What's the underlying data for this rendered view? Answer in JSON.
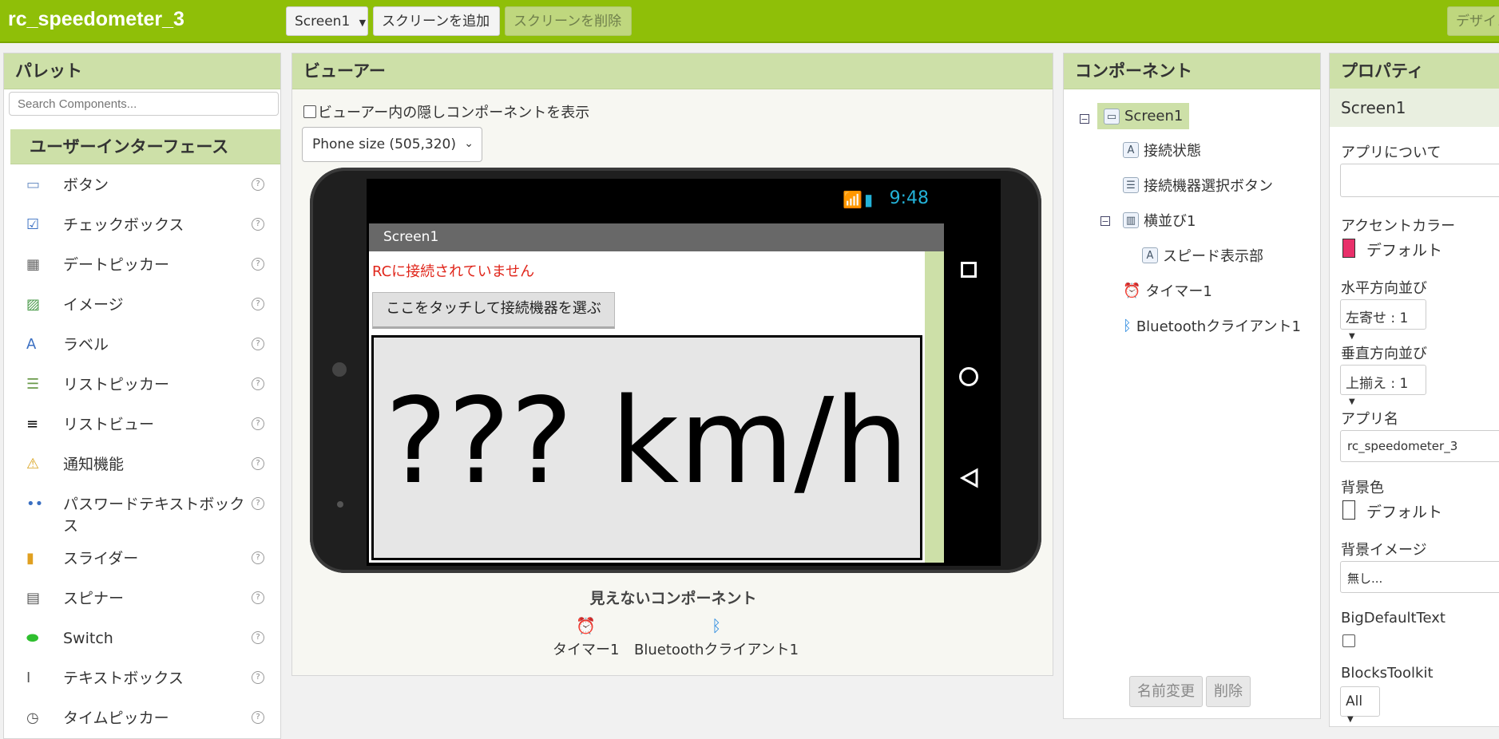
{
  "app": {
    "project_title": "rc_speedometer_3",
    "screen_select": "Screen1",
    "add_screen": "スクリーンを追加",
    "remove_screen": "スクリーンを削除",
    "designer_button": "デザイン編集"
  },
  "palette": {
    "title": "パレット",
    "search_placeholder": "Search Components...",
    "category": "ユーザーインターフェース",
    "help_glyph": "?",
    "items": [
      {
        "label": "ボタン",
        "icon": "button-icon"
      },
      {
        "label": "チェックボックス",
        "icon": "checkbox-icon"
      },
      {
        "label": "デートピッカー",
        "icon": "datepicker-icon"
      },
      {
        "label": "イメージ",
        "icon": "image-icon"
      },
      {
        "label": "ラベル",
        "icon": "label-icon"
      },
      {
        "label": "リストピッカー",
        "icon": "listpicker-icon"
      },
      {
        "label": "リストビュー",
        "icon": "listview-icon"
      },
      {
        "label": "通知機能",
        "icon": "notifier-icon"
      },
      {
        "label": "パスワードテキストボックス",
        "icon": "password-icon"
      },
      {
        "label": "スライダー",
        "icon": "slider-icon"
      },
      {
        "label": "スピナー",
        "icon": "spinner-icon"
      },
      {
        "label": "Switch",
        "icon": "switch-icon"
      },
      {
        "label": "テキストボックス",
        "icon": "textbox-icon"
      },
      {
        "label": "タイムピッカー",
        "icon": "timepicker-icon"
      }
    ]
  },
  "viewer": {
    "title": "ビューアー",
    "hidden_checkbox_label": "ビューアー内の隠しコンポーネントを表示",
    "size_select": "Phone size (505,320)",
    "phone": {
      "time": "9:48",
      "screen_title": "Screen1",
      "status_text": "RCに接続されていません",
      "touch_button": "ここをタッチして接続機器を選ぶ",
      "speed_text": "??? km/h"
    },
    "nonvisible_title": "見えないコンポーネント",
    "nonvisible": [
      {
        "label": "タイマー1",
        "icon": "timer-icon"
      },
      {
        "label": "Bluetoothクライアント1",
        "icon": "bluetooth-icon"
      }
    ]
  },
  "components": {
    "title": "コンポーネント",
    "tree": {
      "screen": "Screen1",
      "conn_status": "接続状態",
      "picker_button": "接続機器選択ボタン",
      "arrangement": "横並び1",
      "speed_label": "スピード表示部",
      "timer": "タイマー1",
      "bluetooth": "Bluetoothクライアント1"
    },
    "rename": "名前変更",
    "delete": "削除"
  },
  "properties": {
    "title": "プロパティ",
    "component": "Screen1",
    "about_label": "アプリについて",
    "accent_label": "アクセントカラー",
    "accent_value": "デフォルト",
    "accent_color": "#e8306a",
    "halign_label": "水平方向並び",
    "halign_value": "左寄せ : 1",
    "valign_label": "垂直方向並び",
    "valign_value": "上揃え : 1",
    "appname_label": "アプリ名",
    "appname_value": "rc_speedometer_3",
    "bg_label": "背景色",
    "bg_value": "デフォルト",
    "bgimage_label": "背景イメージ",
    "bgimage_value": "無し...",
    "bigtext_label": "BigDefaultText",
    "toolkit_label": "BlocksToolkit",
    "toolkit_value": "All"
  },
  "colors": {
    "brand_green": "#8fbf08",
    "panel_header": "#cde0a8",
    "status_red": "#e0261b"
  }
}
